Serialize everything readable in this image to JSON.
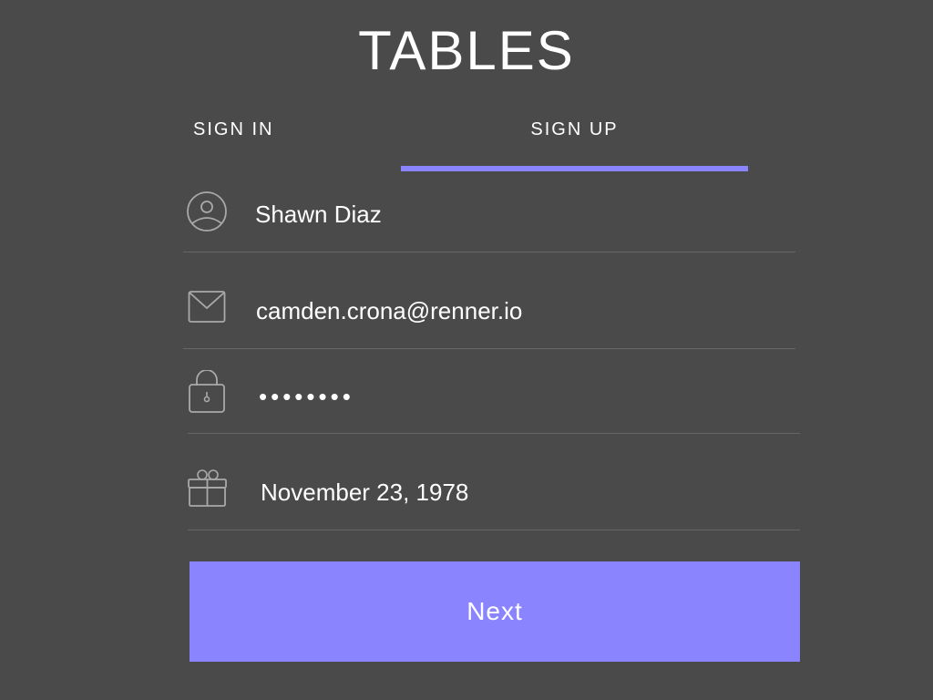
{
  "app": {
    "title": "TABLES"
  },
  "tabs": [
    {
      "label": "SIGN IN",
      "active": false
    },
    {
      "label": "SIGN UP",
      "active": true
    }
  ],
  "form": {
    "name": {
      "value": "Shawn Diaz",
      "icon": "person-circle-icon"
    },
    "email": {
      "value": "camden.crona@renner.io",
      "icon": "envelope-icon"
    },
    "password": {
      "value": "••••••••",
      "icon": "lock-icon"
    },
    "birthday": {
      "value": "November 23, 1978",
      "icon": "gift-icon"
    }
  },
  "actions": {
    "next_label": "Next"
  },
  "colors": {
    "background": "#4a4a4a",
    "accent": "#8a84ff",
    "divider": "#666666",
    "icon": "#a9a9a9"
  }
}
